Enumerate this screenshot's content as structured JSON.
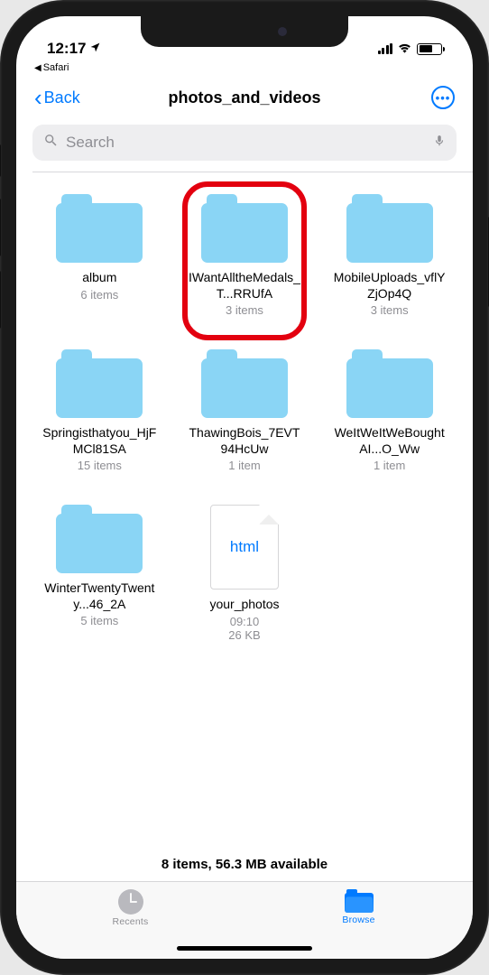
{
  "status": {
    "time": "12:17",
    "breadcrumb_app": "Safari"
  },
  "nav": {
    "back_label": "Back",
    "title": "photos_and_videos"
  },
  "search": {
    "placeholder": "Search"
  },
  "items": [
    {
      "name": "album",
      "meta": "6 items",
      "type": "folder"
    },
    {
      "name": "IWantAlltheMedals_T...RRUfA",
      "meta": "3 items",
      "type": "folder",
      "highlighted": true
    },
    {
      "name": "MobileUploads_vflYZjOp4Q",
      "meta": "3 items",
      "type": "folder"
    },
    {
      "name": "Springisthatyou_HjFMCl81SA",
      "meta": "15 items",
      "type": "folder"
    },
    {
      "name": "ThawingBois_7EVT94HcUw",
      "meta": "1 item",
      "type": "folder"
    },
    {
      "name": "WeItWeItWeBoughtAI...O_Ww",
      "meta": "1 item",
      "type": "folder"
    },
    {
      "name": "WinterTwentyTwenty...46_2A",
      "meta": "5 items",
      "type": "folder"
    },
    {
      "name": "your_photos",
      "meta": "09:10",
      "meta2": "26 KB",
      "type": "html"
    }
  ],
  "footer_status": "8 items, 56.3 MB available",
  "tabs": {
    "recents": "Recents",
    "browse": "Browse"
  },
  "file_badge": "html"
}
